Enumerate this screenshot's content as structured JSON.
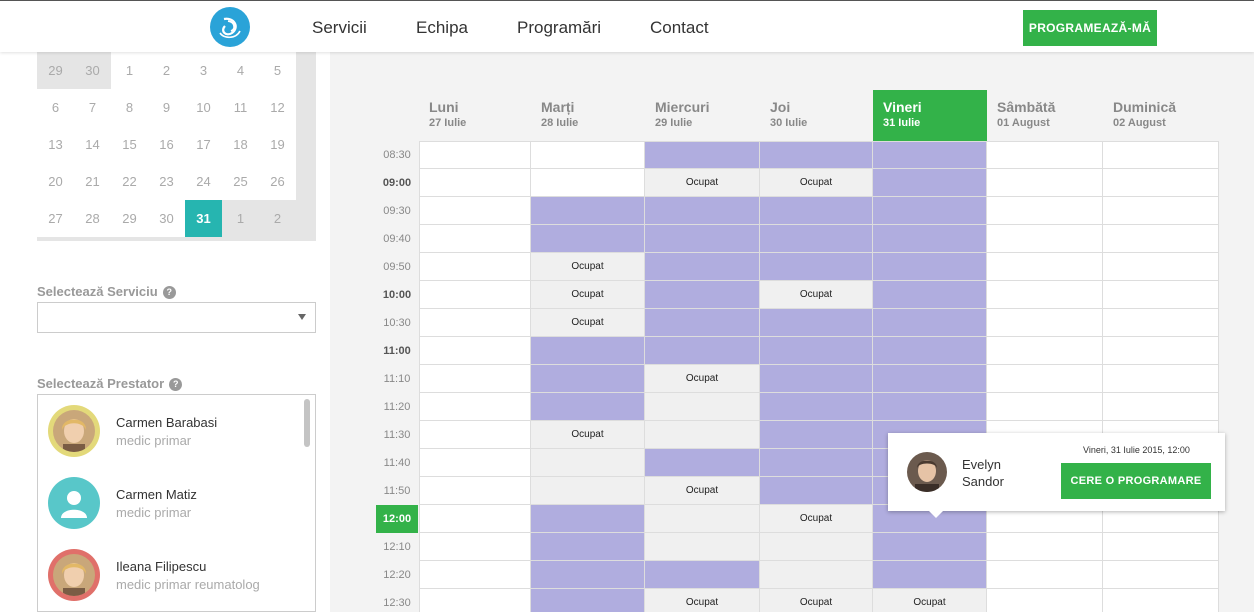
{
  "nav": {
    "items": [
      "Servicii",
      "Echipa",
      "Programări",
      "Contact"
    ],
    "cta_label": "PROGRAMEAZĂ-MĂ"
  },
  "calendar": {
    "rows": [
      [
        {
          "d": "29",
          "s": "other"
        },
        {
          "d": "30",
          "s": "other"
        },
        {
          "d": "1",
          "s": "cur"
        },
        {
          "d": "2",
          "s": "cur"
        },
        {
          "d": "3",
          "s": "cur"
        },
        {
          "d": "4",
          "s": "cur"
        },
        {
          "d": "5",
          "s": "cur"
        }
      ],
      [
        {
          "d": "6",
          "s": "cur"
        },
        {
          "d": "7",
          "s": "cur"
        },
        {
          "d": "8",
          "s": "cur"
        },
        {
          "d": "9",
          "s": "cur"
        },
        {
          "d": "10",
          "s": "cur"
        },
        {
          "d": "11",
          "s": "cur"
        },
        {
          "d": "12",
          "s": "cur"
        }
      ],
      [
        {
          "d": "13",
          "s": "cur"
        },
        {
          "d": "14",
          "s": "cur"
        },
        {
          "d": "15",
          "s": "cur"
        },
        {
          "d": "16",
          "s": "cur"
        },
        {
          "d": "17",
          "s": "cur"
        },
        {
          "d": "18",
          "s": "cur"
        },
        {
          "d": "19",
          "s": "cur"
        }
      ],
      [
        {
          "d": "20",
          "s": "cur"
        },
        {
          "d": "21",
          "s": "cur"
        },
        {
          "d": "22",
          "s": "cur"
        },
        {
          "d": "23",
          "s": "cur"
        },
        {
          "d": "24",
          "s": "cur"
        },
        {
          "d": "25",
          "s": "cur"
        },
        {
          "d": "26",
          "s": "cur"
        }
      ],
      [
        {
          "d": "27",
          "s": "cur"
        },
        {
          "d": "28",
          "s": "cur"
        },
        {
          "d": "29",
          "s": "cur"
        },
        {
          "d": "30",
          "s": "cur"
        },
        {
          "d": "31",
          "s": "sel"
        },
        {
          "d": "1",
          "s": "other"
        },
        {
          "d": "2",
          "s": "other"
        }
      ]
    ]
  },
  "service": {
    "label": "Selectează Serviciu",
    "value": ""
  },
  "provider_section": {
    "label": "Selectează Prestator"
  },
  "providers": [
    {
      "name": "Carmen Barabasi",
      "role": "medic primar",
      "ring": "#e3d97a",
      "photo": "photo"
    },
    {
      "name": "Carmen Matiz",
      "role": "medic primar",
      "ring": "#58c7c9",
      "photo": "user-icon"
    },
    {
      "name": "Ileana Filipescu",
      "role": "medic primar reumatolog",
      "ring": "#e0706a",
      "photo": "photo"
    }
  ],
  "schedule": {
    "days": [
      {
        "name": "Luni",
        "date": "27 Iulie"
      },
      {
        "name": "Marți",
        "date": "28 Iulie"
      },
      {
        "name": "Miercuri",
        "date": "29 Iulie"
      },
      {
        "name": "Joi",
        "date": "30 Iulie"
      },
      {
        "name": "Vineri",
        "date": "31 Iulie",
        "active": true
      },
      {
        "name": "Sâmbătă",
        "date": "01 August"
      },
      {
        "name": "Duminică",
        "date": "02 August"
      }
    ],
    "busy_label": "Ocupat",
    "times": [
      {
        "t": "08:30"
      },
      {
        "t": "09:00",
        "bold": true
      },
      {
        "t": "09:30"
      },
      {
        "t": "09:40"
      },
      {
        "t": "09:50"
      },
      {
        "t": "10:00",
        "bold": true
      },
      {
        "t": "10:30"
      },
      {
        "t": "11:00",
        "bold": true
      },
      {
        "t": "11:10"
      },
      {
        "t": "11:20"
      },
      {
        "t": "11:30"
      },
      {
        "t": "11:40"
      },
      {
        "t": "11:50"
      },
      {
        "t": "12:00",
        "now": true
      },
      {
        "t": "12:10"
      },
      {
        "t": "12:20"
      },
      {
        "t": "12:30"
      }
    ],
    "grid": [
      [
        "F",
        "F",
        "U",
        "U",
        "U",
        "F",
        "F"
      ],
      [
        "F",
        "F",
        "B",
        "B",
        "U",
        "F",
        "F"
      ],
      [
        "F",
        "U",
        "U",
        "U",
        "U",
        "F",
        "F"
      ],
      [
        "F",
        "U",
        "U",
        "U",
        "U",
        "F",
        "F"
      ],
      [
        "F",
        "B",
        "U",
        "U",
        "U",
        "F",
        "F"
      ],
      [
        "F",
        "B",
        "U",
        "B",
        "U",
        "F",
        "F"
      ],
      [
        "F",
        "B",
        "U",
        "U",
        "U",
        "F",
        "F"
      ],
      [
        "F",
        "U",
        "U",
        "U",
        "U",
        "F",
        "F"
      ],
      [
        "F",
        "U",
        "B",
        "U",
        "U",
        "F",
        "F"
      ],
      [
        "F",
        "U",
        "G",
        "U",
        "U",
        "F",
        "F"
      ],
      [
        "F",
        "B",
        "G",
        "U",
        "U",
        "F",
        "F"
      ],
      [
        "F",
        "G",
        "U",
        "U",
        "U",
        "F",
        "F"
      ],
      [
        "F",
        "G",
        "B",
        "U",
        "U",
        "F",
        "F"
      ],
      [
        "F",
        "U",
        "G",
        "B",
        "U",
        "F",
        "F"
      ],
      [
        "F",
        "U",
        "G",
        "G",
        "U",
        "F",
        "F"
      ],
      [
        "F",
        "U",
        "U",
        "G",
        "U",
        "F",
        "F"
      ],
      [
        "F",
        "U",
        "B",
        "B",
        "B",
        "F",
        "F"
      ]
    ]
  },
  "popup": {
    "name": "Evelyn Sandor",
    "datetime": "Vineri, 31 Iulie 2015, 12:00",
    "button": "CERE O PROGRAMARE"
  },
  "colors": {
    "green": "#33b249",
    "teal": "#26b5b0",
    "unavailable": "#b0addf"
  }
}
